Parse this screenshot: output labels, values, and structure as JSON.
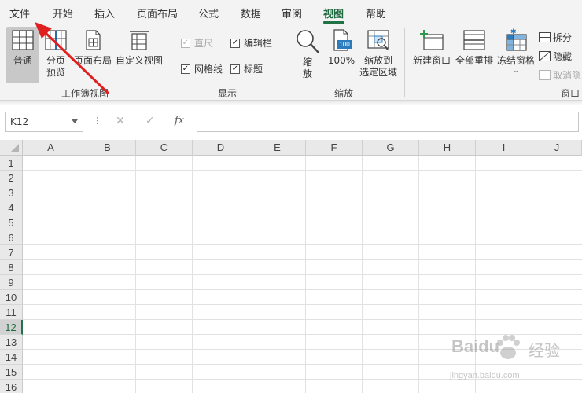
{
  "ribbon": {
    "tabs": [
      {
        "label": "文件",
        "active": false
      },
      {
        "label": "开始",
        "active": false
      },
      {
        "label": "插入",
        "active": false
      },
      {
        "label": "页面布局",
        "active": false
      },
      {
        "label": "公式",
        "active": false
      },
      {
        "label": "数据",
        "active": false
      },
      {
        "label": "审阅",
        "active": false
      },
      {
        "label": "视图",
        "active": true
      },
      {
        "label": "帮助",
        "active": false
      }
    ],
    "accent_color": "#217346",
    "workbook_views": {
      "group_label": "工作簿视图",
      "normal": "普通",
      "page_break_line1": "分页",
      "page_break_line2": "预览",
      "page_layout": "页面布局",
      "custom_views": "自定义视图"
    },
    "show": {
      "group_label": "显示",
      "ruler": {
        "label": "直尺",
        "checked": true,
        "disabled": true
      },
      "formula_bar": {
        "label": "编辑栏",
        "checked": true
      },
      "gridlines": {
        "label": "网格线",
        "checked": true
      },
      "headings": {
        "label": "标题",
        "checked": true
      }
    },
    "zoom": {
      "group_label": "缩放",
      "zoom_line1": "缩",
      "zoom_line2": "放",
      "zoom_100": "100%",
      "zoom_100_icon_text": "100",
      "zoom_selection_line1": "缩放到",
      "zoom_selection_line2": "选定区域"
    },
    "window": {
      "group_label": "窗口",
      "new_window": "新建窗口",
      "arrange_all": "全部重排",
      "freeze_panes": "冻结窗格",
      "split": "拆分",
      "hide": "隐藏",
      "unhide": "取消隐藏"
    }
  },
  "formula_bar": {
    "name_box": "K12",
    "fx": "fx",
    "cancel_symbol": "✕",
    "enter_symbol": "✓",
    "formula_value": ""
  },
  "grid": {
    "columns": [
      "A",
      "B",
      "C",
      "D",
      "E",
      "F",
      "G",
      "H",
      "I",
      "J"
    ],
    "rows": [
      "1",
      "2",
      "3",
      "4",
      "5",
      "6",
      "7",
      "8",
      "9",
      "10",
      "11",
      "12",
      "13",
      "14",
      "15",
      "16"
    ],
    "active_row": "12"
  },
  "annotation": {
    "arrow_color": "#e02020"
  },
  "watermark": {
    "brand": "Baidu",
    "cn": "经验",
    "url": "jingyan.baidu.com"
  }
}
